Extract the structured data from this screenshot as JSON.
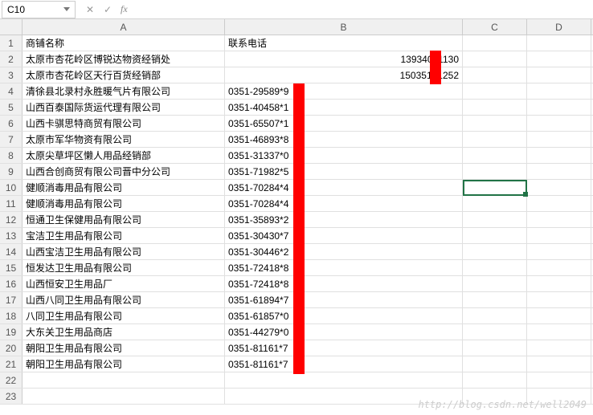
{
  "nameBox": {
    "value": "C10"
  },
  "formulaBar": {
    "value": "",
    "cancel": "✕",
    "confirm": "✓",
    "fx": "fx"
  },
  "columns": [
    "A",
    "B",
    "C",
    "D"
  ],
  "rowNums": [
    "1",
    "2",
    "3",
    "4",
    "5",
    "6",
    "7",
    "8",
    "9",
    "10",
    "11",
    "12",
    "13",
    "14",
    "15",
    "16",
    "17",
    "18",
    "19",
    "20",
    "21",
    "22",
    "23"
  ],
  "headerRow": {
    "a": "商铺名称",
    "b": "联系电话"
  },
  "rows": [
    {
      "a": "太原市杏花岭区博锐达物资经销处",
      "b": "13934041130",
      "bAlignRight": true
    },
    {
      "a": "太原市杏花岭区天行百货经销部",
      "b": "15035171252",
      "bAlignRight": true
    },
    {
      "a": "清徐县北录村永胜暖气片有限公司",
      "b": "0351-29589*9"
    },
    {
      "a": "山西百泰国际货运代理有限公司",
      "b": "0351-40458*1"
    },
    {
      "a": "山西卡骐思特商贸有限公司",
      "b": "0351-65507*1"
    },
    {
      "a": "太原市军华物资有限公司",
      "b": "0351-46893*8"
    },
    {
      "a": "太原尖草坪区懒人用品经销部",
      "b": "0351-31337*0"
    },
    {
      "a": "山西合创商贸有限公司晋中分公司",
      "b": "0351-71982*5"
    },
    {
      "a": "健顺消毒用品有限公司",
      "b": "0351-70284*4"
    },
    {
      "a": "健顺消毒用品有限公司",
      "b": "0351-70284*4"
    },
    {
      "a": "恒通卫生保健用品有限公司",
      "b": "0351-35893*2"
    },
    {
      "a": "宝洁卫生用品有限公司",
      "b": "0351-30430*7"
    },
    {
      "a": "山西宝洁卫生用品有限公司",
      "b": "0351-30446*2"
    },
    {
      "a": "恒发达卫生用品有限公司",
      "b": "0351-72418*8"
    },
    {
      "a": "山西恒安卫生用品厂",
      "b": "0351-72418*8"
    },
    {
      "a": "山西八同卫生用品有限公司",
      "b": "0351-61894*7"
    },
    {
      "a": "八同卫生用品有限公司",
      "b": "0351-61857*0"
    },
    {
      "a": "大东关卫生用品商店",
      "b": "0351-44279*0"
    },
    {
      "a": "朝阳卫生用品有限公司",
      "b": "0351-81161*7"
    },
    {
      "a": "朝阳卫生用品有限公司",
      "b": "0351-81161*7"
    }
  ],
  "watermark": "http://blog.csdn.net/well2049"
}
